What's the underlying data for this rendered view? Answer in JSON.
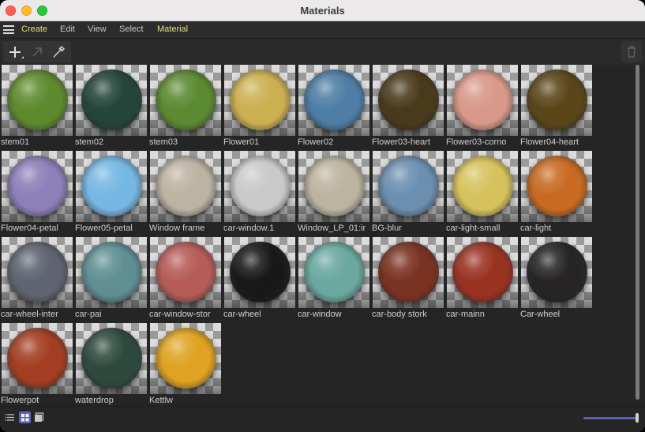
{
  "window": {
    "title": "Materials"
  },
  "menu": [
    "Create",
    "Edit",
    "View",
    "Select",
    "Material"
  ],
  "toolbar": {
    "tools": [
      "add-icon",
      "link-arrow-icon",
      "eyedropper-icon"
    ],
    "trash": "trash-icon"
  },
  "materials": [
    {
      "name": "stem01",
      "color": "#5e8a2e"
    },
    {
      "name": "stem02",
      "color": "#24453b"
    },
    {
      "name": "stem03",
      "color": "#5c8a32"
    },
    {
      "name": "Flower01",
      "color": "#cbb052"
    },
    {
      "name": "Flower02",
      "color": "#4e7ea6"
    },
    {
      "name": "Flower03-heart",
      "color": "#4a3a1c"
    },
    {
      "name": "Flower03-corno",
      "color": "#d8998a"
    },
    {
      "name": "Flower04-heart",
      "color": "#5a4619"
    },
    {
      "name": "Flower04-petal",
      "color": "#8d7fb8"
    },
    {
      "name": "Flower05-petal",
      "color": "#76b7e3"
    },
    {
      "name": "Window frame",
      "color": "#bcb3a2"
    },
    {
      "name": "car-window.1",
      "color": "#c9c9c9"
    },
    {
      "name": "Window_LP_01:ir",
      "color": "#bcb49f"
    },
    {
      "name": "BG-blur",
      "color": "#6c8fb0"
    },
    {
      "name": "car-light-small",
      "color": "#d6c25c"
    },
    {
      "name": "car-light",
      "color": "#c86a22"
    },
    {
      "name": "car-wheel-inter",
      "color": "#5e6470"
    },
    {
      "name": "car-pai",
      "color": "#5f8f93"
    },
    {
      "name": "car-window-stor",
      "color": "#b65c58"
    },
    {
      "name": "car-wheel",
      "color": "#181818"
    },
    {
      "name": "car-window",
      "color": "#6aa8a0"
    },
    {
      "name": "car-body stork",
      "color": "#7a3222"
    },
    {
      "name": "car-mainn",
      "color": "#9a3222"
    },
    {
      "name": "Car-wheel",
      "color": "#262424"
    },
    {
      "name": "Flowerpot",
      "color": "#a33e22"
    },
    {
      "name": "waterdrop",
      "color": "#2e4a3e"
    },
    {
      "name": "Kettlw",
      "color": "#dfa321"
    }
  ],
  "statusbar": {
    "views": [
      "list-view-icon",
      "grid-view-icon",
      "large-view-icon"
    ],
    "zoom_fraction": 1.0
  }
}
